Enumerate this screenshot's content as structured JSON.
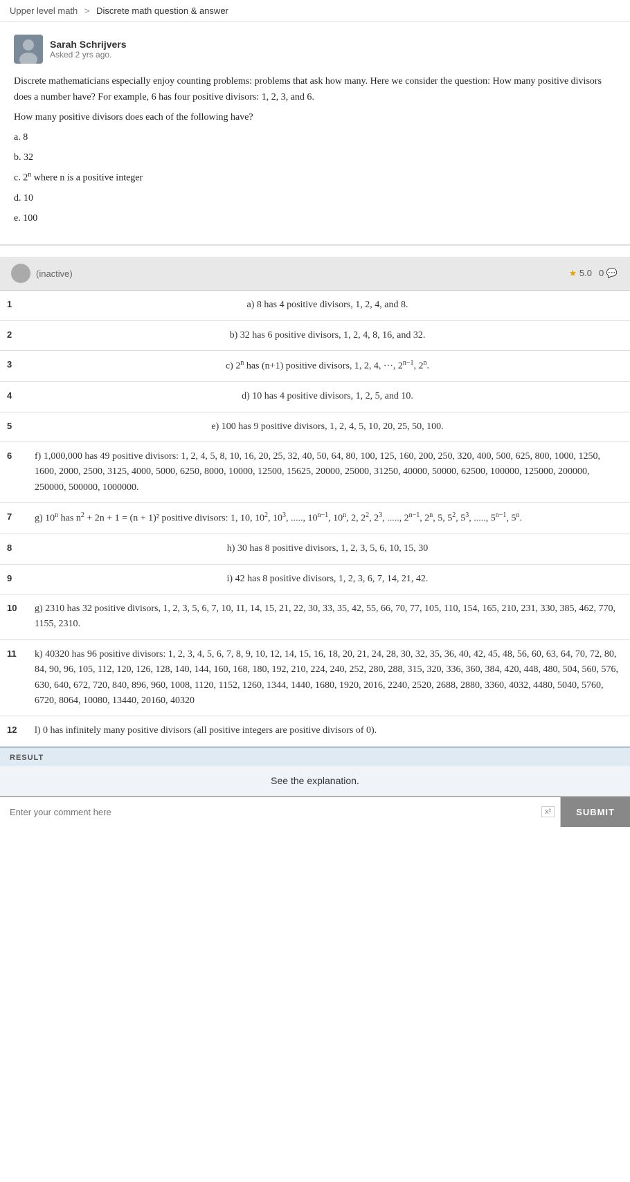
{
  "breadcrumb": {
    "parent": "Upper level math",
    "separator": ">",
    "current": "Discrete math question & answer"
  },
  "question": {
    "author": {
      "name": "Sarah Schrijvers",
      "time": "Asked 2 yrs ago."
    },
    "text_parts": [
      "Discrete mathematicians especially enjoy counting problems: problems that ask how many. Here we consider the question: How many positive divisors does a number have? For example, 6 has four positive divisors: 1, 2, 3, and 6.",
      "How many positive divisors does each of the following have?",
      "a. 8",
      "b. 32",
      "c. 2ⁿ where n is a positive integer",
      "d. 10",
      "e. 100"
    ]
  },
  "answer": {
    "user": "(inactive)",
    "rating": "5.0",
    "comments": "0",
    "rows": [
      {
        "num": "1",
        "text": "a) 8 has 4 positive divisors, 1, 2, 4, and 8.",
        "centered": true
      },
      {
        "num": "2",
        "text": "b) 32 has 6 positive divisors, 1, 2, 4, 8, 16, and 32.",
        "centered": true
      },
      {
        "num": "3",
        "text": "c) 2ⁿ has (n+1) positive divisors, 1, 2, 4, ⋯, 2ⁿ⁻¹, 2ⁿ.",
        "centered": true
      },
      {
        "num": "4",
        "text": "d) 10 has 4 positive divisors, 1, 2, 5, and 10.",
        "centered": true
      },
      {
        "num": "5",
        "text": "e) 100 has 9 positive divisors, 1, 2, 4, 5, 10, 20, 25, 50, 100.",
        "centered": true
      },
      {
        "num": "6",
        "text": "f) 1,000,000 has 49 positive divisors:  1, 2, 4, 5, 8, 10, 16, 20, 25, 32, 40, 50, 64, 80, 100, 125, 160, 200, 250, 320, 400, 500, 625, 800, 1000, 1250, 1600, 2000, 2500, 3125, 4000, 5000, 6250, 8000, 10000, 12500, 15625, 20000, 25000, 31250, 40000, 50000, 62500, 100000, 125000, 200000, 250000, 500000, 1000000.",
        "centered": false
      },
      {
        "num": "7",
        "text": "g) 10ⁿ has n² + 2n + 1 = (n + 1)² positive divisors:  1, 10, 10², 10³, ....., 10ⁿ⁻¹, 10ⁿ, 2, 2², 2³, ....., 2ⁿ⁻¹, 2ⁿ, 5, 5², 5³, ....., 5ⁿ⁻¹, 5ⁿ.",
        "centered": false
      },
      {
        "num": "8",
        "text": "h) 30 has 8 positive divisors, 1, 2, 3, 5, 6, 10, 15, 30",
        "centered": true
      },
      {
        "num": "9",
        "text": "i) 42 has 8 positive divisors, 1, 2, 3, 6, 7, 14, 21, 42.",
        "centered": true
      },
      {
        "num": "10",
        "text": "g) 2310 has 32 positive divisors, 1, 2, 3, 5, 6, 7, 10, 11, 14, 15, 21, 22, 30, 33, 35, 42, 55, 66, 70, 77, 105, 110, 154, 165, 210, 231, 330, 385, 462, 770, 1155, 2310.",
        "centered": false
      },
      {
        "num": "11",
        "text": "k) 40320 has 96 positive divisors: 1, 2, 3, 4, 5, 6, 7, 8, 9, 10, 12, 14, 15, 16, 18, 20, 21, 24, 28, 30, 32, 35, 36, 40, 42, 45, 48, 56, 60, 63, 64, 70, 72, 80, 84, 90, 96, 105, 112, 120, 126, 128, 140, 144, 160, 168, 180, 192, 210, 224, 240, 252, 280, 288, 315, 320, 336, 360, 384, 420, 448, 480, 504, 560, 576, 630, 640, 672, 720, 840, 896, 960, 1008, 1120, 1152, 1260, 1344, 1440, 1680, 1920, 2016, 2240, 2520, 2688, 2880, 3360, 4032, 4480, 5040, 5760, 6720, 8064, 10080, 13440, 20160, 40320",
        "centered": false
      },
      {
        "num": "12",
        "text": "l) 0 has infinitely many positive divisors (all positive integers are positive divisors of 0).",
        "centered": false
      }
    ]
  },
  "result": {
    "label": "RESULT",
    "text": "See the explanation."
  },
  "comment": {
    "placeholder": "Enter your comment here",
    "superscript_label": "x²",
    "submit_label": "SUBMIT"
  }
}
